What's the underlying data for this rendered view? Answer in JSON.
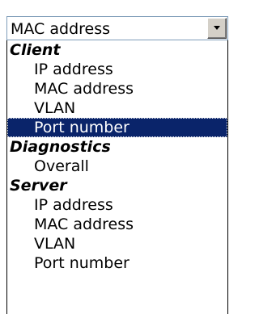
{
  "select": {
    "value": "MAC address",
    "icon": "chevron-down-icon"
  },
  "groups": [
    {
      "label": "Client",
      "options": [
        {
          "label": "IP address",
          "selected": false
        },
        {
          "label": "MAC address",
          "selected": false
        },
        {
          "label": "VLAN",
          "selected": false
        },
        {
          "label": "Port number",
          "selected": true
        }
      ]
    },
    {
      "label": "Diagnostics",
      "options": [
        {
          "label": "Overall",
          "selected": false
        }
      ]
    },
    {
      "label": "Server",
      "options": [
        {
          "label": "IP address",
          "selected": false
        },
        {
          "label": "MAC address",
          "selected": false
        },
        {
          "label": "VLAN",
          "selected": false
        },
        {
          "label": "Port number",
          "selected": false
        }
      ]
    }
  ],
  "colors": {
    "selected_background": "#0a246a",
    "selected_text": "#ffffff",
    "border": "#7f9db9"
  }
}
